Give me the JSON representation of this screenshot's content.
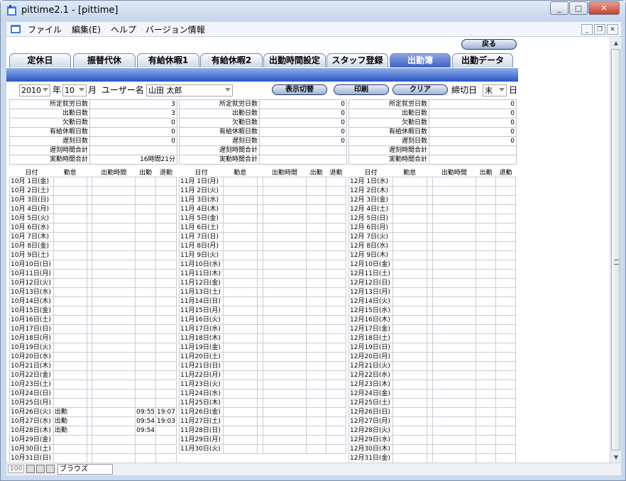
{
  "window": {
    "title": "pittime2.1 - [pittime]"
  },
  "menu": [
    "ファイル",
    "編集(E)",
    "ヘルプ",
    "バージョン情報"
  ],
  "back_label": "戻る",
  "tabs": [
    "定休日",
    "振替代休",
    "有給休暇1",
    "有給休暇2",
    "出勤時間設定",
    "スタッフ登録",
    "出勤簿",
    "出勤データ"
  ],
  "active_tab": 6,
  "controls": {
    "year": "2010",
    "year_label": "年",
    "month": "10",
    "month_label": "月",
    "user_label": "ユーザー名",
    "user_name": "山田 太郎",
    "toggle_btn": "表示切替",
    "print_btn": "印刷",
    "clear_btn": "クリア",
    "cutoff_label": "締切日",
    "cutoff_value": "末",
    "day_label": "日"
  },
  "summary_labels": [
    "所定就労日数",
    "出勤日数",
    "欠勤日数",
    "有給休暇日数",
    "遅刻日数",
    "遅刻時間合計",
    "実勤時間合計"
  ],
  "summaries": [
    [
      "3",
      "3",
      "0",
      "0",
      "0",
      "",
      "16時間21分"
    ],
    [
      "0",
      "0",
      "0",
      "0",
      "0",
      "",
      ""
    ],
    [
      "0",
      "0",
      "0",
      "0",
      "0",
      "",
      ""
    ]
  ],
  "columns": [
    "日付",
    "勤怠",
    "出勤時間",
    "出勤",
    "退勤"
  ],
  "months": [
    {
      "rows": [
        [
          "10月 1日(金)",
          "",
          "",
          "",
          ""
        ],
        [
          "10月 2日(土)",
          "",
          "",
          "",
          ""
        ],
        [
          "10月 3日(日)",
          "",
          "",
          "",
          ""
        ],
        [
          "10月 4日(月)",
          "",
          "",
          "",
          ""
        ],
        [
          "10月 5日(火)",
          "",
          "",
          "",
          ""
        ],
        [
          "10月 6日(水)",
          "",
          "",
          "",
          ""
        ],
        [
          "10月 7日(木)",
          "",
          "",
          "",
          ""
        ],
        [
          "10月 8日(金)",
          "",
          "",
          "",
          ""
        ],
        [
          "10月 9日(土)",
          "",
          "",
          "",
          ""
        ],
        [
          "10月10日(日)",
          "",
          "",
          "",
          ""
        ],
        [
          "10月11日(月)",
          "",
          "",
          "",
          ""
        ],
        [
          "10月12日(火)",
          "",
          "",
          "",
          ""
        ],
        [
          "10月13日(水)",
          "",
          "",
          "",
          ""
        ],
        [
          "10月14日(木)",
          "",
          "",
          "",
          ""
        ],
        [
          "10月15日(金)",
          "",
          "",
          "",
          ""
        ],
        [
          "10月16日(土)",
          "",
          "",
          "",
          ""
        ],
        [
          "10月17日(日)",
          "",
          "",
          "",
          ""
        ],
        [
          "10月18日(月)",
          "",
          "",
          "",
          ""
        ],
        [
          "10月19日(火)",
          "",
          "",
          "",
          ""
        ],
        [
          "10月20日(水)",
          "",
          "",
          "",
          ""
        ],
        [
          "10月21日(木)",
          "",
          "",
          "",
          ""
        ],
        [
          "10月22日(金)",
          "",
          "",
          "",
          ""
        ],
        [
          "10月23日(土)",
          "",
          "",
          "",
          ""
        ],
        [
          "10月24日(日)",
          "",
          "",
          "",
          ""
        ],
        [
          "10月25日(月)",
          "",
          "",
          "",
          ""
        ],
        [
          "10月26日(火)",
          "出勤",
          "",
          "09:55",
          "19:07"
        ],
        [
          "10月27日(水)",
          "出勤",
          "",
          "09:54",
          "19:03"
        ],
        [
          "10月28日(木)",
          "出勤",
          "",
          "09:54",
          ""
        ],
        [
          "10月29日(金)",
          "",
          "",
          "",
          ""
        ],
        [
          "10月30日(土)",
          "",
          "",
          "",
          ""
        ],
        [
          "10月31日(日)",
          "",
          "",
          "",
          ""
        ]
      ]
    },
    {
      "rows": [
        [
          "11月 1日(月)",
          "",
          "",
          "",
          ""
        ],
        [
          "11月 2日(火)",
          "",
          "",
          "",
          ""
        ],
        [
          "11月 3日(水)",
          "",
          "",
          "",
          ""
        ],
        [
          "11月 4日(木)",
          "",
          "",
          "",
          ""
        ],
        [
          "11月 5日(金)",
          "",
          "",
          "",
          ""
        ],
        [
          "11月 6日(土)",
          "",
          "",
          "",
          ""
        ],
        [
          "11月 7日(日)",
          "",
          "",
          "",
          ""
        ],
        [
          "11月 8日(月)",
          "",
          "",
          "",
          ""
        ],
        [
          "11月 9日(火)",
          "",
          "",
          "",
          ""
        ],
        [
          "11月10日(水)",
          "",
          "",
          "",
          ""
        ],
        [
          "11月11日(木)",
          "",
          "",
          "",
          ""
        ],
        [
          "11月12日(金)",
          "",
          "",
          "",
          ""
        ],
        [
          "11月13日(土)",
          "",
          "",
          "",
          ""
        ],
        [
          "11月14日(日)",
          "",
          "",
          "",
          ""
        ],
        [
          "11月15日(月)",
          "",
          "",
          "",
          ""
        ],
        [
          "11月16日(火)",
          "",
          "",
          "",
          ""
        ],
        [
          "11月17日(水)",
          "",
          "",
          "",
          ""
        ],
        [
          "11月18日(木)",
          "",
          "",
          "",
          ""
        ],
        [
          "11月19日(金)",
          "",
          "",
          "",
          ""
        ],
        [
          "11月20日(土)",
          "",
          "",
          "",
          ""
        ],
        [
          "11月21日(日)",
          "",
          "",
          "",
          ""
        ],
        [
          "11月22日(月)",
          "",
          "",
          "",
          ""
        ],
        [
          "11月23日(火)",
          "",
          "",
          "",
          ""
        ],
        [
          "11月24日(水)",
          "",
          "",
          "",
          ""
        ],
        [
          "11月25日(木)",
          "",
          "",
          "",
          ""
        ],
        [
          "11月26日(金)",
          "",
          "",
          "",
          ""
        ],
        [
          "11月27日(土)",
          "",
          "",
          "",
          ""
        ],
        [
          "11月28日(日)",
          "",
          "",
          "",
          ""
        ],
        [
          "11月29日(月)",
          "",
          "",
          "",
          ""
        ],
        [
          "11月30日(火)",
          "",
          "",
          "",
          ""
        ]
      ]
    },
    {
      "rows": [
        [
          "12月 1日(水)",
          "",
          "",
          "",
          ""
        ],
        [
          "12月 2日(木)",
          "",
          "",
          "",
          ""
        ],
        [
          "12月 3日(金)",
          "",
          "",
          "",
          ""
        ],
        [
          "12月 4日(土)",
          "",
          "",
          "",
          ""
        ],
        [
          "12月 5日(日)",
          "",
          "",
          "",
          ""
        ],
        [
          "12月 6日(月)",
          "",
          "",
          "",
          ""
        ],
        [
          "12月 7日(火)",
          "",
          "",
          "",
          ""
        ],
        [
          "12月 8日(水)",
          "",
          "",
          "",
          ""
        ],
        [
          "12月 9日(木)",
          "",
          "",
          "",
          ""
        ],
        [
          "12月10日(金)",
          "",
          "",
          "",
          ""
        ],
        [
          "12月11日(土)",
          "",
          "",
          "",
          ""
        ],
        [
          "12月12日(日)",
          "",
          "",
          "",
          ""
        ],
        [
          "12月13日(月)",
          "",
          "",
          "",
          ""
        ],
        [
          "12月14日(火)",
          "",
          "",
          "",
          ""
        ],
        [
          "12月15日(水)",
          "",
          "",
          "",
          ""
        ],
        [
          "12月16日(木)",
          "",
          "",
          "",
          ""
        ],
        [
          "12月17日(金)",
          "",
          "",
          "",
          ""
        ],
        [
          "12月18日(土)",
          "",
          "",
          "",
          ""
        ],
        [
          "12月19日(日)",
          "",
          "",
          "",
          ""
        ],
        [
          "12月20日(月)",
          "",
          "",
          "",
          ""
        ],
        [
          "12月21日(火)",
          "",
          "",
          "",
          ""
        ],
        [
          "12月22日(水)",
          "",
          "",
          "",
          ""
        ],
        [
          "12月23日(木)",
          "",
          "",
          "",
          ""
        ],
        [
          "12月24日(金)",
          "",
          "",
          "",
          ""
        ],
        [
          "12月25日(土)",
          "",
          "",
          "",
          ""
        ],
        [
          "12月26日(日)",
          "",
          "",
          "",
          ""
        ],
        [
          "12月27日(月)",
          "",
          "",
          "",
          ""
        ],
        [
          "12月28日(火)",
          "",
          "",
          "",
          ""
        ],
        [
          "12月29日(水)",
          "",
          "",
          "",
          ""
        ],
        [
          "12月30日(木)",
          "",
          "",
          "",
          ""
        ],
        [
          "12月31日(金)",
          "",
          "",
          "",
          ""
        ]
      ]
    }
  ],
  "status": {
    "zoom": "100",
    "mode": "ブラウズ"
  }
}
